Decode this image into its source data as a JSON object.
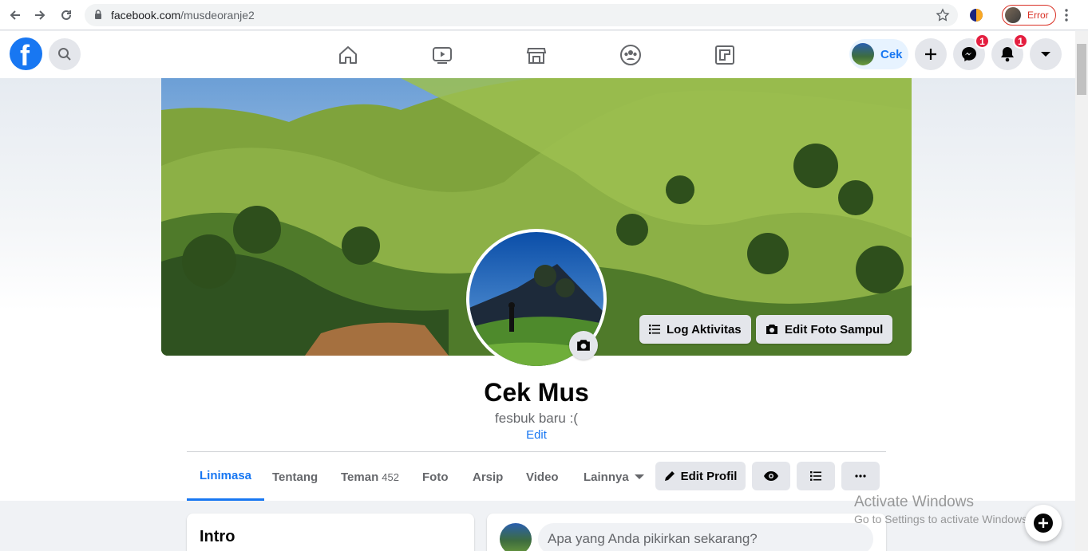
{
  "browser": {
    "url_domain": "facebook.com",
    "url_path": "/musdeoranje2",
    "profile_status": "Error"
  },
  "topnav": {
    "me_name": "Cek",
    "messenger_badge": "1",
    "notifications_badge": "1"
  },
  "profile": {
    "name": "Cek Mus",
    "bio": "fesbuk baru :(",
    "edit_bio": "Edit",
    "log_activity": "Log Aktivitas",
    "edit_cover": "Edit Foto Sampul"
  },
  "tabs": [
    {
      "label": "Linimasa",
      "active": true
    },
    {
      "label": "Tentang"
    },
    {
      "label": "Teman",
      "count": "452"
    },
    {
      "label": "Foto"
    },
    {
      "label": "Arsip"
    },
    {
      "label": "Video"
    },
    {
      "label": "Lainnya"
    }
  ],
  "actions": {
    "edit_profile": "Edit Profil"
  },
  "intro": {
    "title": "Intro"
  },
  "composer": {
    "placeholder": "Apa yang Anda pikirkan sekarang?"
  },
  "watermark": {
    "line1": "Activate Windows",
    "line2": "Go to Settings to activate Windows."
  },
  "colors": {
    "accent": "#1877f2",
    "badge": "#e41e3f"
  }
}
